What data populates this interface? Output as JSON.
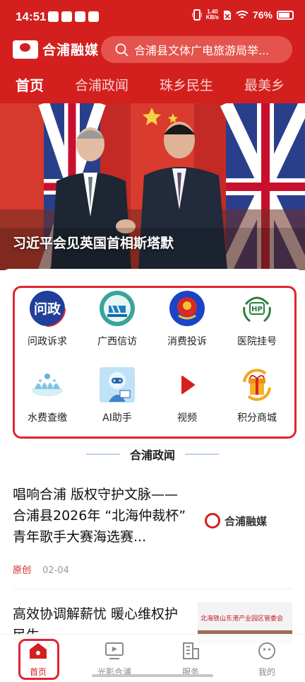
{
  "status_bar": {
    "time": "14:51",
    "network_speed_value": "1.40",
    "network_speed_unit": "KB/s",
    "battery": "76%"
  },
  "header": {
    "app_name": "合浦融媒",
    "search_placeholder": "合浦县文体广电旅游局举..."
  },
  "tabs": [
    {
      "label": "首页",
      "active": true
    },
    {
      "label": "合浦政闻",
      "active": false
    },
    {
      "label": "珠乡民生",
      "active": false
    },
    {
      "label": "最美乡",
      "active": false
    }
  ],
  "hero": {
    "caption": "习近平会见英国首相斯塔默"
  },
  "services": [
    {
      "label": "问政诉求",
      "icon": "wenzheng-icon",
      "icon_text": "问政"
    },
    {
      "label": "广西信访",
      "icon": "petition-icon"
    },
    {
      "label": "消费投诉",
      "icon": "consumer-complaint-icon"
    },
    {
      "label": "医院挂号",
      "icon": "hospital-icon",
      "icon_text": "HP"
    },
    {
      "label": "水费查缴",
      "icon": "water-splash-icon"
    },
    {
      "label": "AI助手",
      "icon": "ai-robot-icon"
    },
    {
      "label": "视频",
      "icon": "play-icon"
    },
    {
      "label": "积分商城",
      "icon": "gift-icon"
    }
  ],
  "section": {
    "title": "合浦政闻"
  },
  "news": [
    {
      "title": "唱响合浦 版权守护文脉——合浦县2026年 “北海仲裁杯” 青年歌手大赛海选赛...",
      "tag": "原创",
      "date": "02-04",
      "thumb_text": "合浦融媒"
    },
    {
      "title": "高效协调解薪忧 暖心维权护民生",
      "thumb_text": "北海铁山东港产业园区管委会"
    }
  ],
  "bottom_nav": [
    {
      "label": "首页",
      "icon": "home-icon",
      "active": true
    },
    {
      "label": "光影合浦",
      "icon": "video-screen-icon",
      "active": false
    },
    {
      "label": "服务",
      "icon": "building-icon",
      "active": false
    },
    {
      "label": "我的",
      "icon": "smiley-face-icon",
      "active": false
    }
  ],
  "colors": {
    "brand_red": "#d41f1f",
    "highlight_frame": "#e02433"
  }
}
